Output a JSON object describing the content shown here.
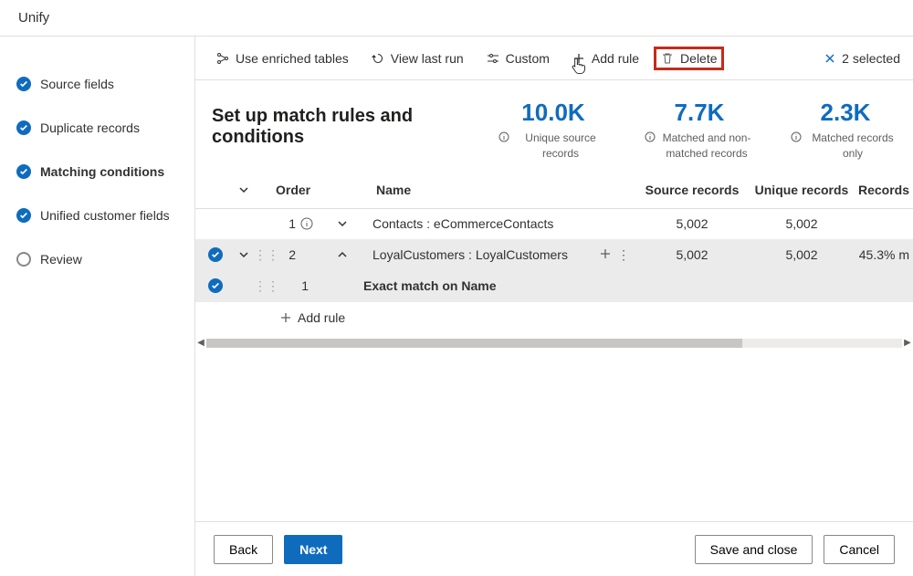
{
  "app": {
    "title": "Unify"
  },
  "steps": [
    {
      "label": "Source fields",
      "state": "done"
    },
    {
      "label": "Duplicate records",
      "state": "done"
    },
    {
      "label": "Matching conditions",
      "state": "active"
    },
    {
      "label": "Unified customer fields",
      "state": "done"
    },
    {
      "label": "Review",
      "state": "pending"
    }
  ],
  "toolbar": {
    "enriched": "Use enriched tables",
    "viewlast": "View last run",
    "custom": "Custom",
    "addrule": "Add rule",
    "delete": "Delete",
    "selected": "2 selected"
  },
  "heading": "Set up match rules and conditions",
  "stats": [
    {
      "value": "10.0K",
      "label": "Unique source records"
    },
    {
      "value": "7.7K",
      "label": "Matched and non-matched records"
    },
    {
      "value": "2.3K",
      "label": "Matched records only"
    }
  ],
  "columns": {
    "order": "Order",
    "name": "Name",
    "source": "Source records",
    "unique": "Unique records",
    "records": "Records"
  },
  "rows": [
    {
      "idx": "1",
      "name": "Contacts : eCommerceContacts",
      "source": "5,002",
      "unique": "5,002",
      "rec": "",
      "selected": false,
      "hasInfo": true,
      "chev": "down",
      "showPlus": false
    },
    {
      "idx": "2",
      "name": "LoyalCustomers : LoyalCustomers",
      "source": "5,002",
      "unique": "5,002",
      "rec": "45.3% m",
      "selected": true,
      "hasDrag": true,
      "chev": "up",
      "chev0": "down",
      "showPlus": true
    },
    {
      "idx": "1",
      "name": "Exact match on Name",
      "selected": true,
      "sub": true,
      "hasDrag": true
    }
  ],
  "addrule_row": "Add rule",
  "footer": {
    "back": "Back",
    "next": "Next",
    "save": "Save and close",
    "cancel": "Cancel"
  }
}
